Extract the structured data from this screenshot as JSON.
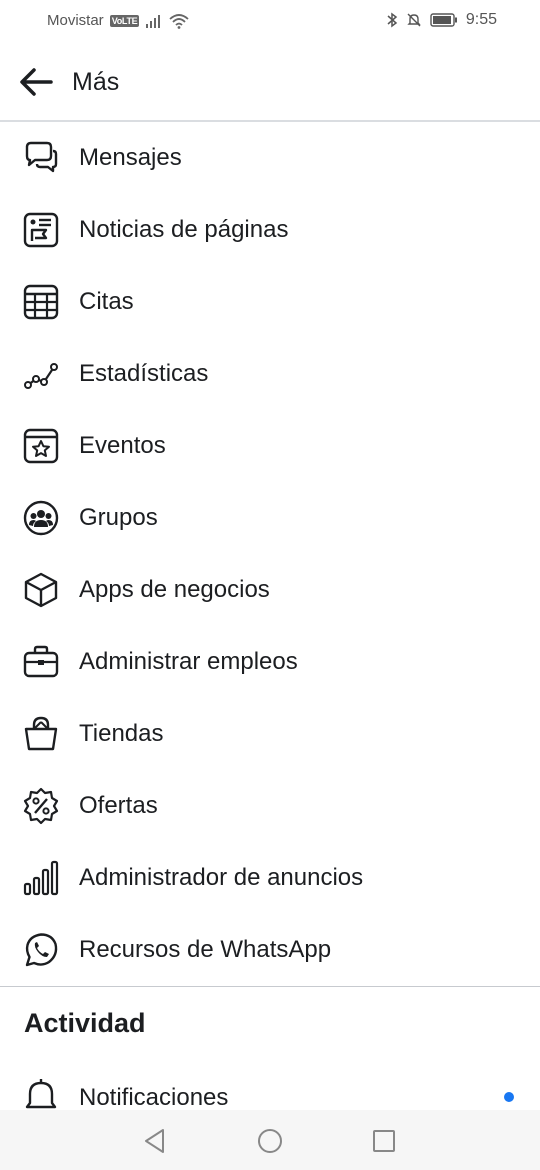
{
  "status_bar": {
    "carrier": "Movistar",
    "network_badge": "VoLTE",
    "time": "9:55"
  },
  "header": {
    "title": "Más"
  },
  "menu_items": [
    {
      "label": "Mensajes",
      "icon": "messages-icon"
    },
    {
      "label": "Noticias de páginas",
      "icon": "page-news-icon"
    },
    {
      "label": "Citas",
      "icon": "calendar-icon"
    },
    {
      "label": "Estadísticas",
      "icon": "insights-icon"
    },
    {
      "label": "Eventos",
      "icon": "event-star-icon"
    },
    {
      "label": "Grupos",
      "icon": "groups-icon"
    },
    {
      "label": "Apps de negocios",
      "icon": "cube-icon"
    },
    {
      "label": "Administrar empleos",
      "icon": "briefcase-icon"
    },
    {
      "label": "Tiendas",
      "icon": "shopping-bag-icon"
    },
    {
      "label": "Ofertas",
      "icon": "offers-percent-icon"
    },
    {
      "label": "Administrador de anuncios",
      "icon": "ads-bar-chart-icon"
    },
    {
      "label": "Recursos de WhatsApp",
      "icon": "whatsapp-icon"
    }
  ],
  "activity": {
    "section_title": "Actividad",
    "notifications": {
      "label": "Notificaciones",
      "icon": "bell-icon",
      "indicator_color": "#1877f2"
    }
  },
  "colors": {
    "text": "#1c1e21",
    "divider": "#c7cacf",
    "unread_dot": "#1877f2"
  }
}
